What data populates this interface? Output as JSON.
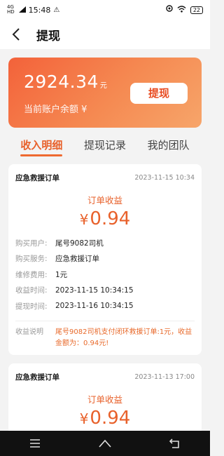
{
  "statusbar": {
    "network": "4G",
    "network_sub": "HD",
    "time": "15:48",
    "battery": "22"
  },
  "header": {
    "title": "提现"
  },
  "balance": {
    "amount": "2924.34",
    "unit": "元",
    "label": "当前账户余额 ¥",
    "withdraw_button": "提现"
  },
  "tabs": [
    {
      "label": "收入明细",
      "active": true
    },
    {
      "label": "提现记录",
      "active": false
    },
    {
      "label": "我的团队",
      "active": false
    }
  ],
  "orders": [
    {
      "type": "应急救援订单",
      "date": "2023-11-15 10:34",
      "earn_label": "订单收益",
      "currency": "¥",
      "earn_amount": "0.94",
      "rows": [
        {
          "key": "购买用户:",
          "value": "尾号9082司机"
        },
        {
          "key": "购买服务:",
          "value": "应急救援订单"
        },
        {
          "key": "维修费用:",
          "value": "1元"
        },
        {
          "key": "收益时间:",
          "value": "2023-11-15 10:34:15"
        },
        {
          "key": "提现时间:",
          "value": "2023-11-16 10:34:15"
        }
      ],
      "note_key": "收益说明",
      "note_value": "尾号9082司机支付闭环救援订单:1元，收益金额为：0.94元!"
    },
    {
      "type": "应急救援订单",
      "date": "2023-11-13 17:00",
      "earn_label": "订单收益",
      "currency": "¥",
      "earn_amount": "0.94"
    }
  ],
  "icons": {
    "back": "chevron-left-icon",
    "menu": "menu-icon",
    "home": "home-icon",
    "return": "return-icon",
    "wifi": "wifi-icon",
    "location": "location-icon",
    "warning": "warning-icon"
  },
  "colors": {
    "accent": "#e8612b",
    "card_gradient_start": "#f3623a",
    "card_gradient_end": "#f7a56a"
  }
}
